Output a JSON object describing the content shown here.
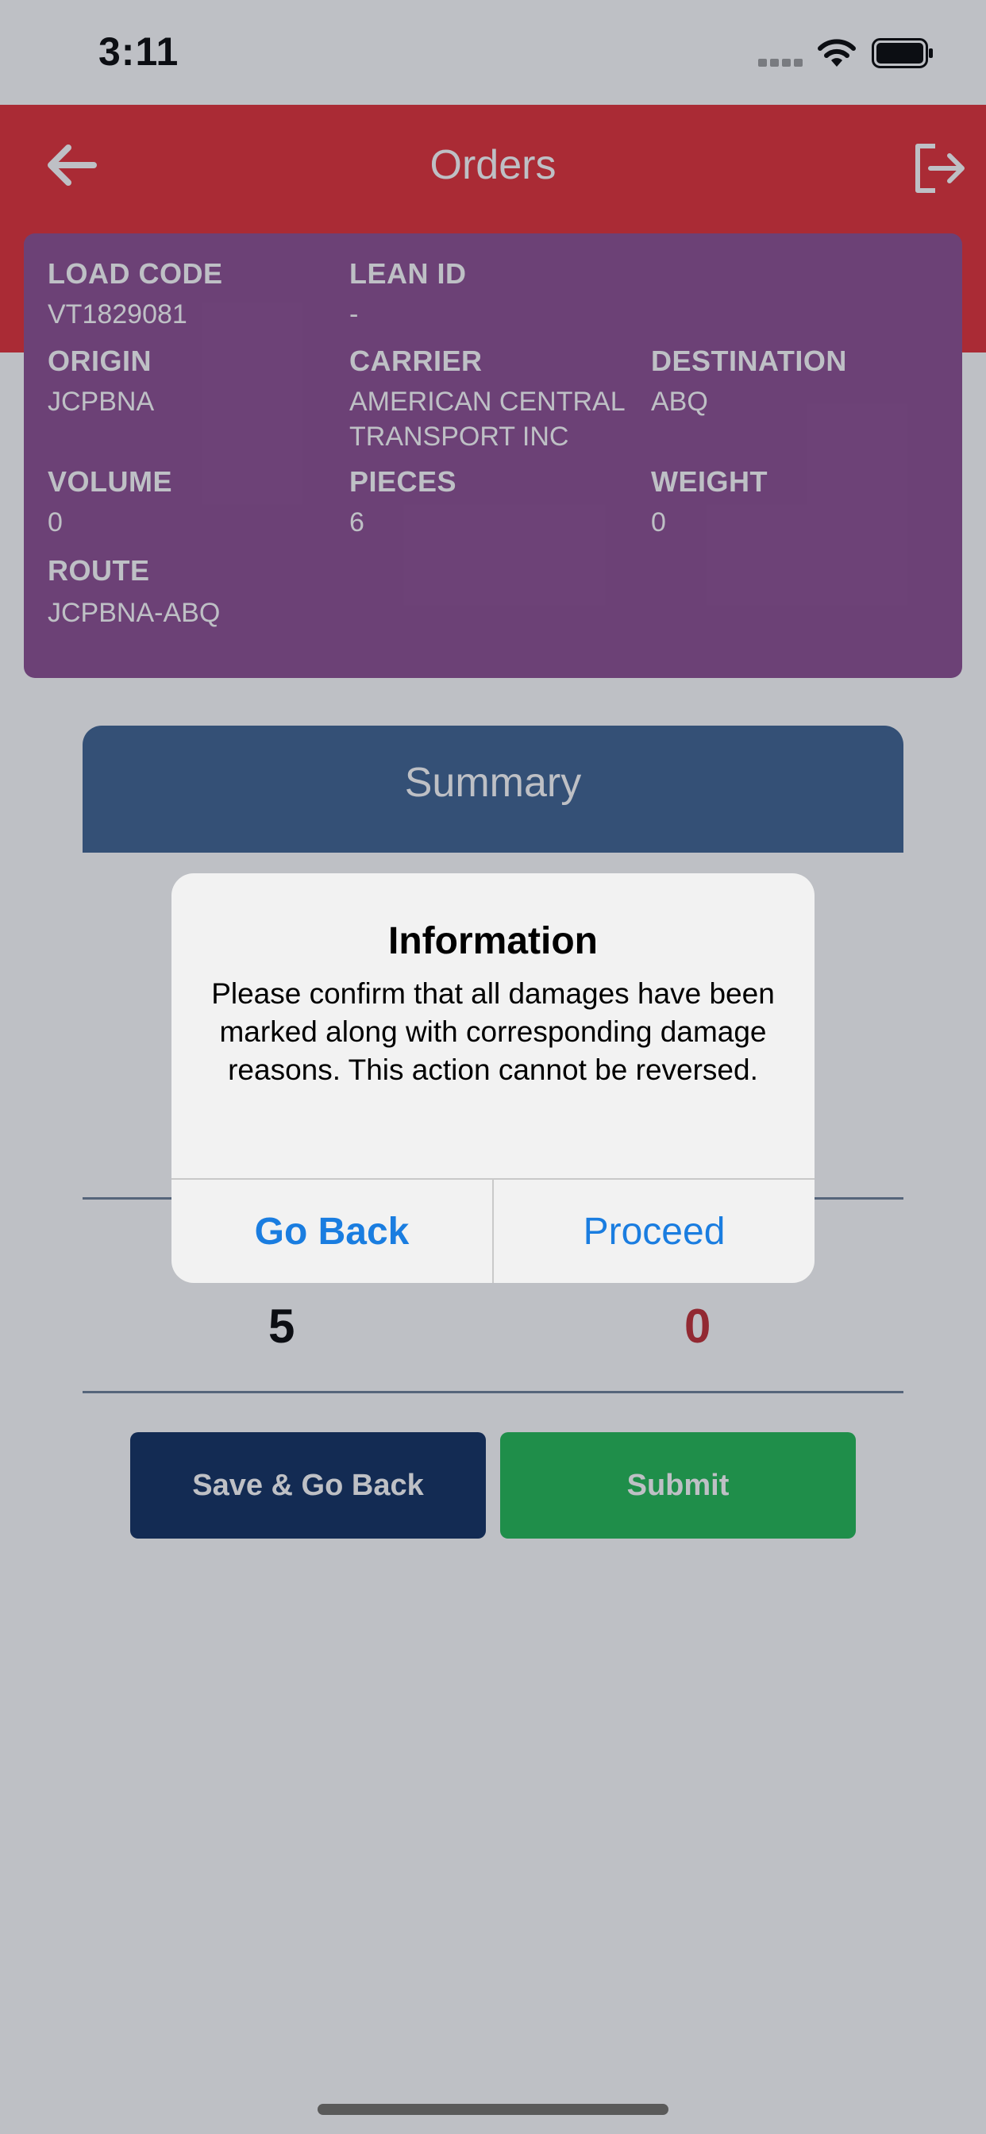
{
  "status_bar": {
    "time": "3:11"
  },
  "header": {
    "title": "Orders"
  },
  "info_card": {
    "load_code": {
      "label": "LOAD CODE",
      "value": "VT1829081"
    },
    "lean_id": {
      "label": "LEAN ID",
      "value": "-"
    },
    "origin": {
      "label": "ORIGIN",
      "value": "JCPBNA"
    },
    "carrier": {
      "label": "CARRIER",
      "value_line1": "AMERICAN CENTRAL",
      "value_line2": "TRANSPORT INC"
    },
    "destination": {
      "label": "DESTINATION",
      "value": "ABQ"
    },
    "volume": {
      "label": "VOLUME",
      "value": "0"
    },
    "pieces": {
      "label": "PIECES",
      "value": "6"
    },
    "weight": {
      "label": "WEIGHT",
      "value": "0"
    },
    "route": {
      "label": "ROUTE",
      "value": "JCPBNA-ABQ"
    }
  },
  "summary": {
    "title": "Summary",
    "count_left": "5",
    "count_right": "0",
    "save_button": "Save & Go Back",
    "submit_button": "Submit"
  },
  "dialog": {
    "title": "Information",
    "message": "Please confirm that all damages have been marked along with corresponding damage reasons. This action cannot be reversed.",
    "go_back": "Go Back",
    "proceed": "Proceed"
  },
  "colors": {
    "header": "#e22a32",
    "card": "#8a4a8f",
    "summary_header": "#3a5f8f",
    "save_button": "#0b2a5c",
    "submit_button": "#1cb850",
    "alert_button_text": "#1a7de0",
    "count_right": "#c0272d"
  },
  "icons": {
    "back": "arrow-left-icon",
    "logout": "logout-icon",
    "wifi": "wifi-icon",
    "battery": "battery-icon",
    "signal": "cellular-signal-icon"
  }
}
